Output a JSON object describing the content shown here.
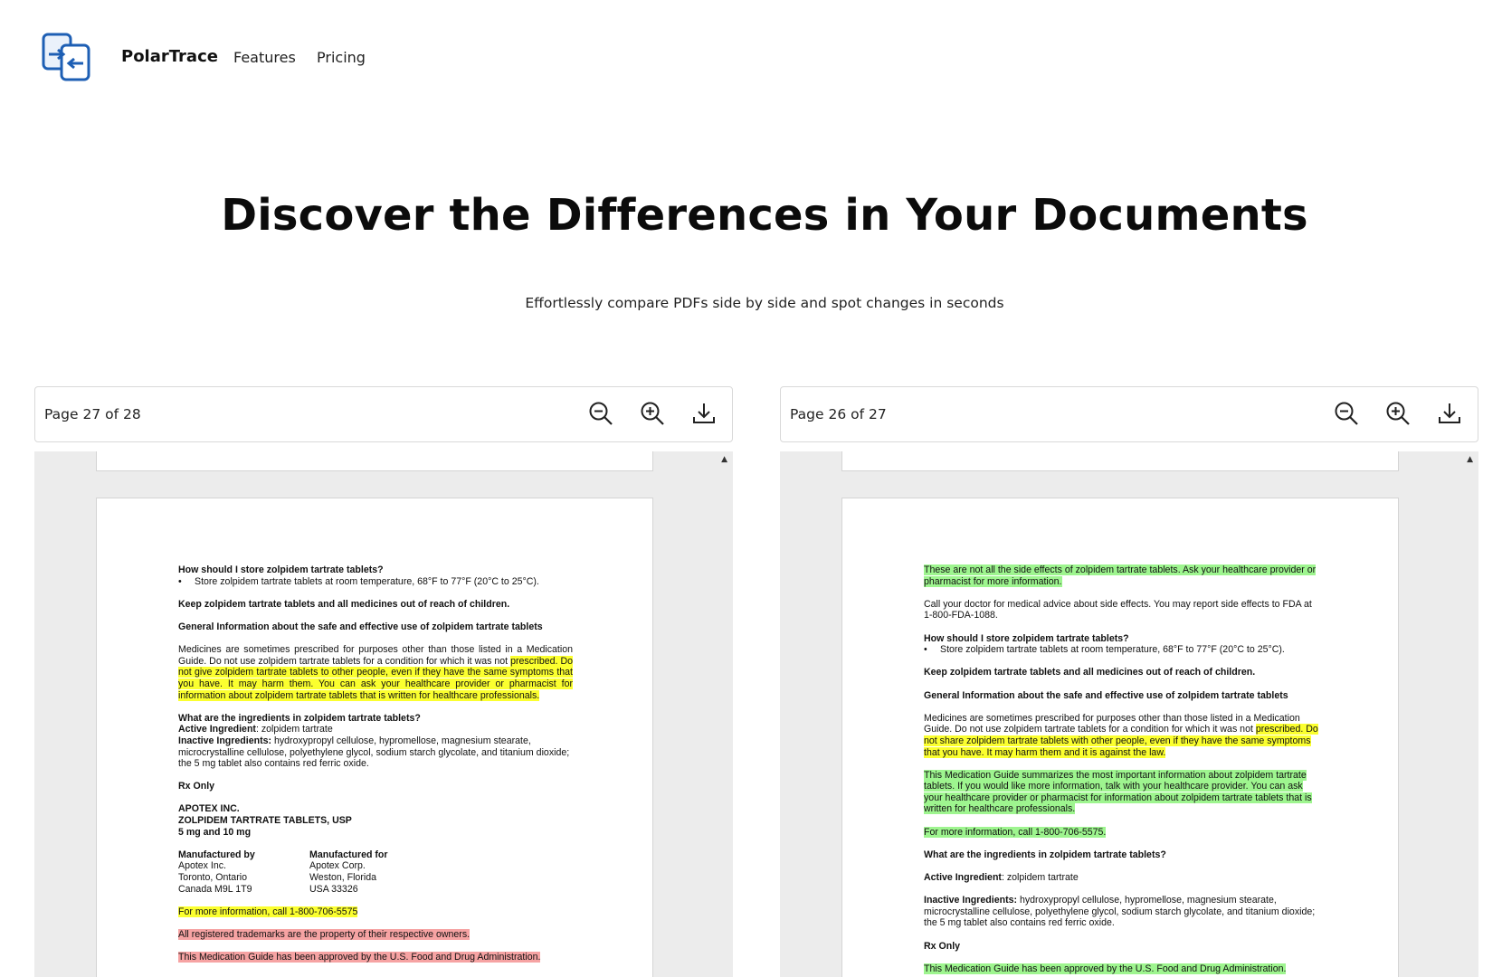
{
  "header": {
    "brand": "PolarTrace",
    "nav": {
      "features": "Features",
      "pricing": "Pricing"
    }
  },
  "hero": {
    "title": "Discover the Differences in Your Documents",
    "subtitle": "Effortlessly compare PDFs side by side and spot changes in seconds"
  },
  "colors": {
    "yellow_highlight": "#fbff2f",
    "green_highlight": "#9ef58f",
    "red_highlight": "#f6a3a3",
    "logo_blue": "#1e5fb4"
  },
  "left_viewer": {
    "page_indicator": "Page 27 of 28",
    "icons": [
      "zoom-out-icon",
      "zoom-in-icon",
      "download-icon"
    ],
    "doc": {
      "h_store": "How should I store zolpidem tartrate tablets?",
      "store_bullet": "Store zolpidem tartrate tablets at room temperature, 68°F to 77°F (20°C to 25°C).",
      "keep_out": "Keep zolpidem tartrate tablets and all medicines out of reach of children.",
      "h_general": "General Information about the safe and effective use of zolpidem tartrate tablets",
      "general_plain": "Medicines are sometimes prescribed for purposes other than those listed in a Medication Guide. Do not use zolpidem tartrate tablets for a condition for which it was not",
      "general_highlight": "prescribed. Do not give zolpidem tartrate tablets to other people, even if they have the same symptoms that you have. It may harm them. You can ask your healthcare provider or pharmacist for information about zolpidem tartrate tablets that is written for healthcare professionals.",
      "h_ingredients": "What are the ingredients in zolpidem tartrate tablets?",
      "active_label": "Active Ingredient",
      "active_value": ": zolpidem tartrate",
      "inactive_label": "Inactive Ingredients:",
      "inactive_value": " hydroxypropyl cellulose, hypromellose, magnesium stearate, microcrystalline cellulose, polyethylene glycol, sodium starch glycolate, and titanium dioxide; the 5 mg tablet also contains red ferric oxide.",
      "rx_only": "Rx Only",
      "company": "APOTEX INC.",
      "product": "ZOLPIDEM TARTRATE TABLETS, USP",
      "strengths": "5 mg and 10 mg",
      "mfd_by_label": "Manufactured by",
      "mfd_by_lines": [
        "Apotex Inc.",
        "Toronto, Ontario",
        "Canada M9L 1T9"
      ],
      "mfd_for_label": "Manufactured for",
      "mfd_for_lines": [
        "Apotex Corp.",
        "Weston, Florida",
        "USA 33326"
      ],
      "more_info": "For more information, call 1-800-706-5575",
      "trademarks": "All registered trademarks are the property of their respective owners.",
      "approved": "This Medication Guide has been approved by the U.S. Food and Drug Administration."
    }
  },
  "right_viewer": {
    "page_indicator": "Page 26 of 27",
    "icons": [
      "zoom-out-icon",
      "zoom-in-icon",
      "download-icon"
    ],
    "doc": {
      "side_effects": "These are not all the side effects of zolpidem tartrate tablets. Ask your healthcare provider or pharmacist for more information.",
      "call_doctor": "Call your doctor for medical advice about side effects. You may report side effects to FDA at 1-800-FDA-1088.",
      "h_store": "How should I store zolpidem tartrate tablets?",
      "store_bullet": "Store zolpidem tartrate tablets at room temperature, 68°F to 77°F (20°C to 25°C).",
      "keep_out": "Keep zolpidem tartrate tablets and all medicines out of reach of children.",
      "h_general": "General Information about the safe and effective use of zolpidem tartrate tablets",
      "general_plain": "Medicines are sometimes prescribed for purposes other than those listed in a Medication Guide. Do not use zolpidem tartrate tablets for a condition for which it was not",
      "general_highlight": "prescribed. Do not share zolpidem tartrate tablets with other people, even if they have the same symptoms that you have. It may harm them and it is against the law.",
      "summary": "This Medication Guide summarizes the most important information about zolpidem tartrate tablets. If you would like more information, talk with your healthcare provider. You can ask your healthcare provider or pharmacist for information about zolpidem tartrate tablets that is written for healthcare professionals.",
      "more_info": "For more information, call 1-800-706-5575.",
      "h_ingredients": "What are the ingredients in zolpidem tartrate tablets?",
      "active_label": "Active Ingredient",
      "active_value": ": zolpidem tartrate",
      "inactive_label": "Inactive Ingredients:",
      "inactive_value": " hydroxypropyl cellulose, hypromellose, magnesium stearate, microcrystalline cellulose, polyethylene glycol, sodium starch glycolate, and titanium dioxide; the 5 mg tablet also contains red ferric oxide.",
      "rx_only": "Rx Only",
      "approved": "This Medication Guide has been approved by the U.S. Food and Drug Administration."
    }
  }
}
